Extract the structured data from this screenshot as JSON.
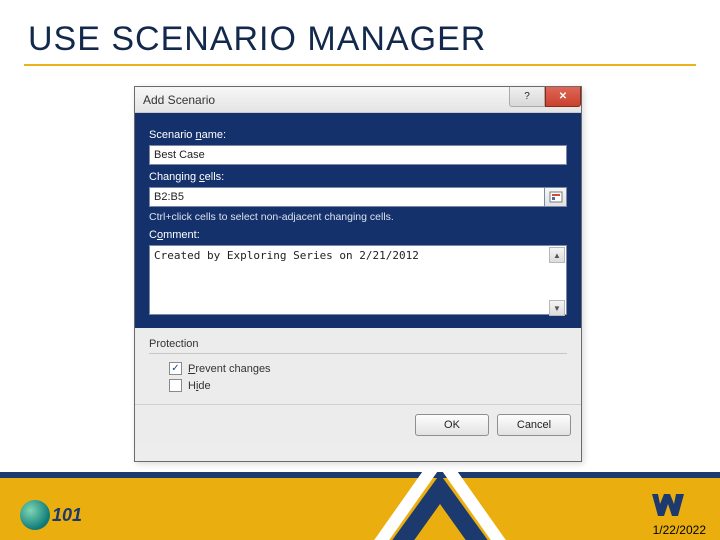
{
  "slide": {
    "title": "USE SCENARIO MANAGER",
    "date": "1/22/2022",
    "logo_text": "101"
  },
  "dialog": {
    "title": "Add Scenario",
    "labels": {
      "scenario_name": "Scenario name:",
      "changing_cells": "Changing cells:",
      "hint": "Ctrl+click cells to select non-adjacent changing cells.",
      "comment": "Comment:",
      "protection": "Protection",
      "prevent_changes": "Prevent changes",
      "hide": "Hide"
    },
    "values": {
      "scenario_name": "Best Case",
      "changing_cells": "B2:B5",
      "comment": "Created by Exploring Series on 2/21/2012",
      "prevent_changes_checked": true,
      "hide_checked": false
    },
    "buttons": {
      "ok": "OK",
      "cancel": "Cancel",
      "help": "?",
      "close": "✕"
    }
  }
}
